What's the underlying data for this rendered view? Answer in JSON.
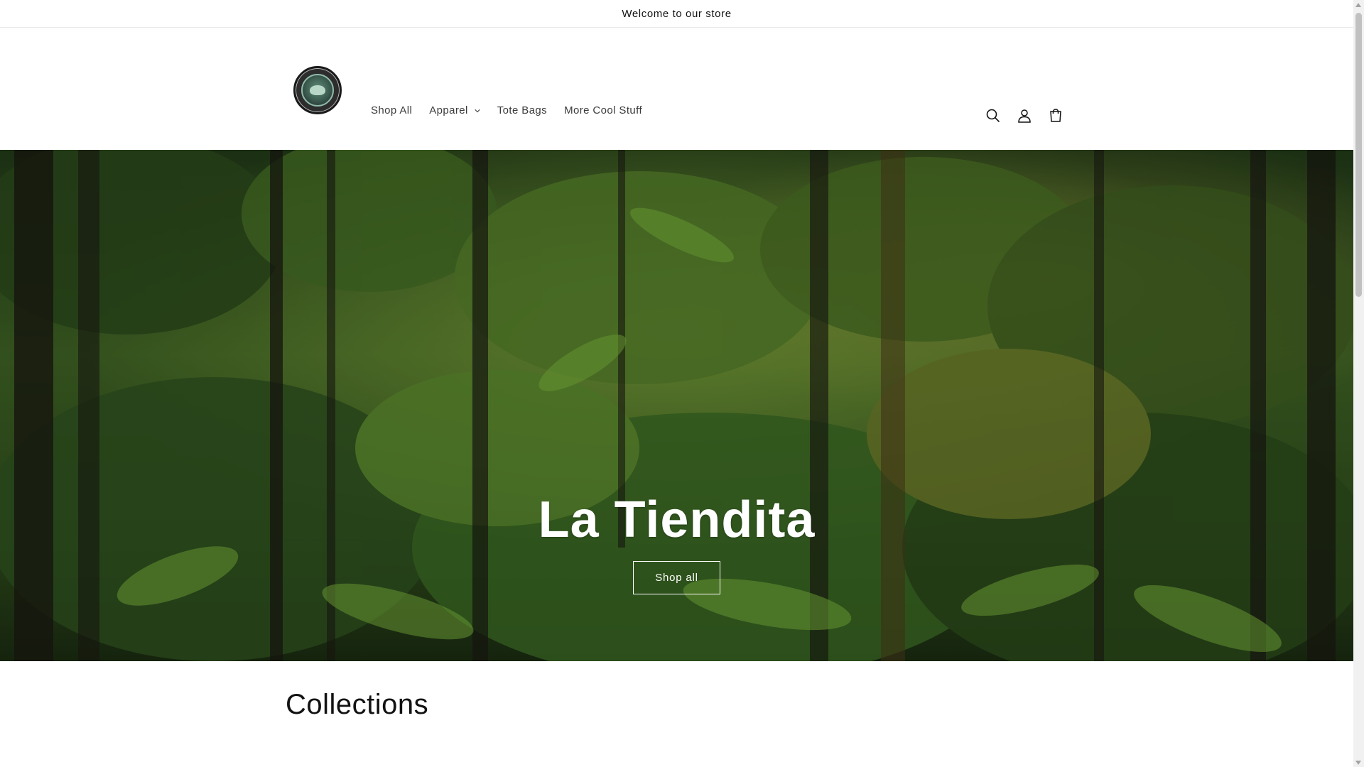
{
  "announcement": {
    "text": "Welcome to our store"
  },
  "header": {
    "logo_alt": "Let's Go store logo",
    "nav": [
      {
        "label": "Shop All",
        "has_dropdown": false
      },
      {
        "label": "Apparel",
        "has_dropdown": true
      },
      {
        "label": "Tote Bags",
        "has_dropdown": false
      },
      {
        "label": "More Cool Stuff",
        "has_dropdown": false
      }
    ],
    "icons": [
      "search-icon",
      "account-icon",
      "cart-icon"
    ]
  },
  "hero": {
    "title": "La Tiendita",
    "button_label": "Shop all"
  },
  "collections": {
    "title": "Collections"
  },
  "colors": {
    "text": "#121212",
    "nav_text": "#3b3b3b",
    "hero_text": "#ffffff",
    "background": "#ffffff"
  }
}
